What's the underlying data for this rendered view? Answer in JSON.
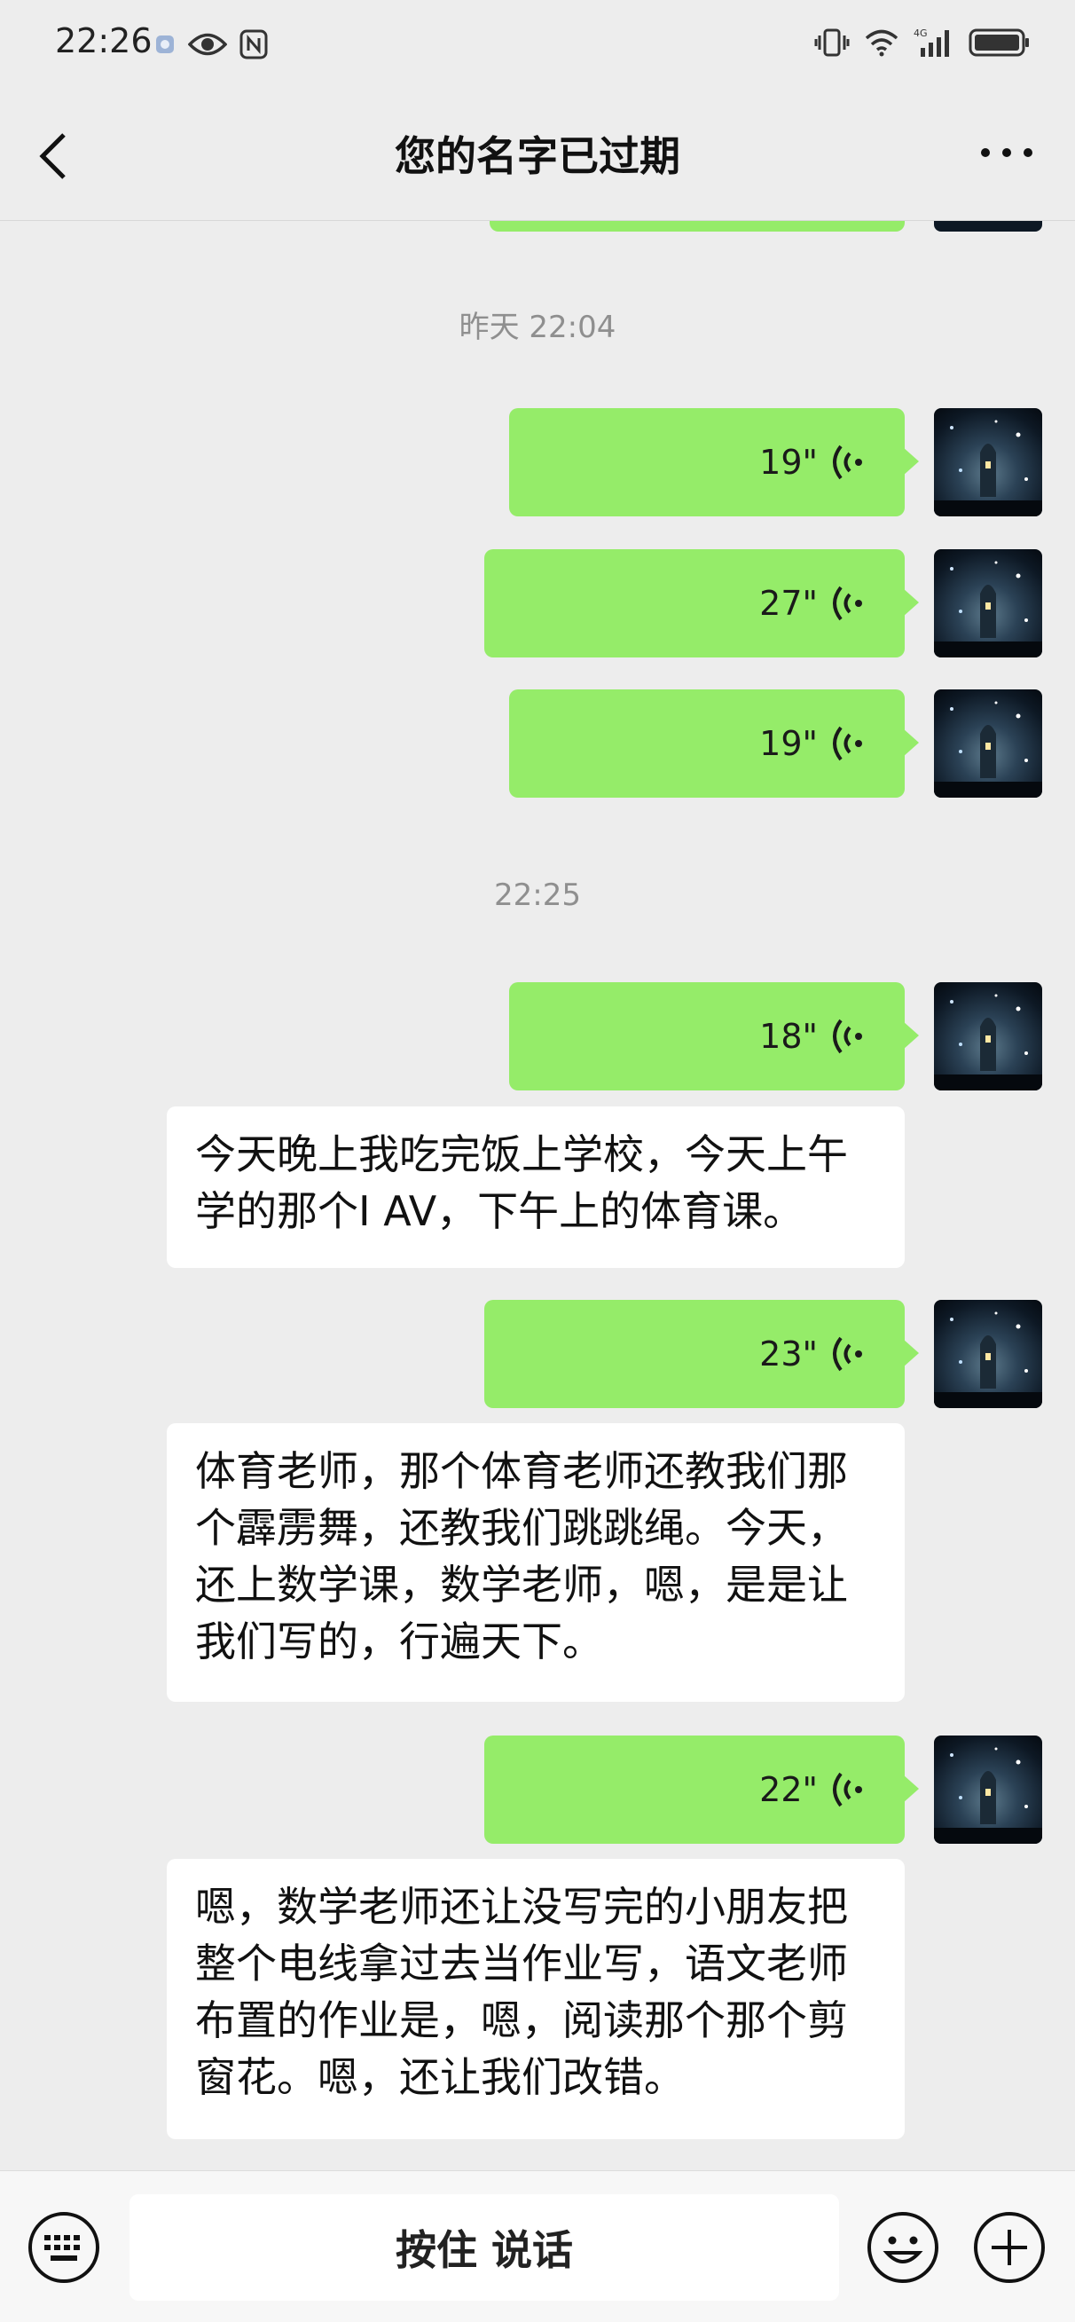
{
  "status_bar": {
    "time": "22:26",
    "icons_left": [
      "notification-dot-icon",
      "eye-icon",
      "nfc-icon"
    ],
    "icons_right": [
      "vibrate-icon",
      "wifi-icon",
      "signal-4g-icon",
      "battery-icon"
    ],
    "network_label": "4G"
  },
  "header": {
    "title": "您的名字已过期",
    "back_icon": "chevron-left-icon",
    "more_icon": "more-dots-icon"
  },
  "messages": {
    "ts1": "昨天 22:04",
    "v1": "19\"",
    "v2": "27\"",
    "v3": "19\"",
    "ts2": "22:25",
    "v4": "18\"",
    "t4": "今天晚上我吃完饭上学校，今天上午学的那个I AV，下午上的体育课。",
    "v5": "23\"",
    "t5": "体育老师，那个体育老师还教我们那个霹雳舞，还教我们跳跳绳。今天，还上数学课，数学老师，嗯，是是让我们写的，行遍天下。",
    "v6": "22\"",
    "t6": "嗯，数学老师还让没写完的小朋友把整个电线拿过去当作业写，语文老师布置的作业是，嗯，阅读那个那个剪窗花。嗯，还让我们改错。"
  },
  "input_bar": {
    "hold_to_talk": "按住 说话",
    "left_icon": "keyboard-icon",
    "right_icons": [
      "emoji-icon",
      "plus-icon"
    ]
  },
  "colors": {
    "background": "#ededed",
    "outgoing_bubble": "#95ec69",
    "incoming_bubble": "#ffffff",
    "timestamp_text": "#8f8f8f"
  }
}
